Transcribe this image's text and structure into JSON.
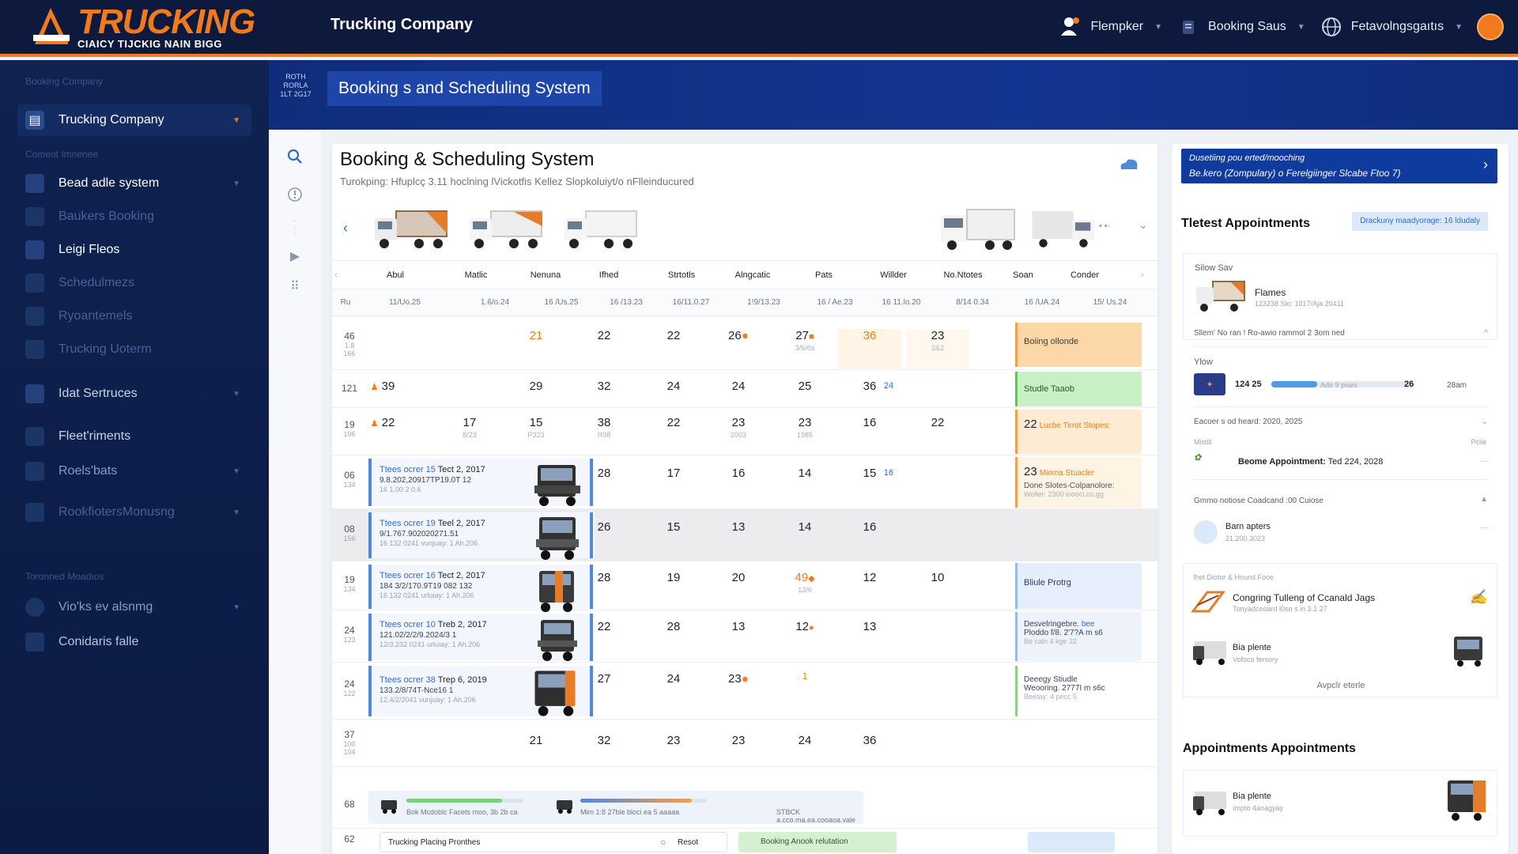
{
  "header": {
    "logo_title": "TRUCKING",
    "logo_sub": "CIAICY TIJCKIG NAIN BIGG",
    "app_title": "Trucking Company",
    "menu": [
      {
        "label": "Flempker",
        "icon": "user-truck-icon"
      },
      {
        "label": "Booking Saus",
        "icon": "clipboard-icon"
      },
      {
        "label": "Fetavolngsgaıtıs",
        "icon": "globe-icon"
      }
    ]
  },
  "sidebar": {
    "section1": "Booking Company",
    "company": "Trucking Company",
    "section2": "Comeot Imnenee",
    "items": [
      "Bead adle system",
      "Baukers Booking",
      "Leigi Fleos",
      "Schedulmezs",
      "Ryoantemels",
      "Trucking Uoterm",
      "Idat Sertruces",
      "Fleet'riments",
      "Roels'bats",
      "RookfiotersMonusng"
    ],
    "section3": "Toronned Moadıos",
    "items2": [
      "Vio'ks ev alsnmg",
      "Conidaris falle"
    ]
  },
  "banner": {
    "stamp": "ROTH RORLA 1LT 2G17",
    "title": "Booking s and Scheduling System"
  },
  "main": {
    "title": "Booking & Scheduling System",
    "subtitle": "Turokping: Hfuplcç 3.11 hoclning lVickotfis Kellez Slopkoluiyt/o nFlleinducured",
    "columns": [
      "Abul",
      "Matlic",
      "Nenuna",
      "Ifhed",
      "Strtotls",
      "Alngcatic",
      "Pats",
      "Willder",
      "No.Ntotes",
      "Soan",
      "Conder"
    ],
    "dates": [
      "Ru",
      "11/Uo.25",
      "1.6/o.24",
      "16 /Us.25",
      "16 /13.23",
      "16/11.0.27",
      "1!9/13.23",
      "16 / Ae.23",
      "16 11.lo.20",
      "8/14 0.34",
      "16 /UA.24",
      "15/ Us.24"
    ],
    "rows": [
      {
        "label": "46",
        "sub": "1.8 166",
        "cells": [
          "",
          "21",
          "22",
          "22",
          "26",
          "27",
          "36",
          "23"
        ],
        "cell_subs": [
          "",
          "",
          "",
          "",
          "",
          "3/6/6s",
          "",
          "2&2"
        ],
        "status": "Boiing ollonde",
        "status_sub": ""
      },
      {
        "label": "121",
        "sub": "",
        "cells": [
          "39",
          "29",
          "32",
          "24",
          "24",
          "25",
          "36",
          "24"
        ],
        "cell_subs": [],
        "status": "Studle Taaob",
        "status_sub": ""
      },
      {
        "label": "19",
        "sub": "196",
        "cells": [
          "22",
          "17",
          "15",
          "38",
          "22",
          "23",
          "23",
          "16",
          "22"
        ],
        "cell_subs": [
          "",
          "8/23",
          "P323",
          "R98",
          "",
          "2003",
          "1985",
          "",
          ""
        ],
        "status": "22",
        "status_sub": "Lucbe Tirrot Stopes:"
      },
      {
        "label": "06",
        "sub": "134",
        "card": {
          "line1": "Ttees ocrer 15",
          "date": "Tect 2, 2017",
          "line2": "9.8.202,20917TP19.0T 12",
          "line3": "16 1,00 2 0.6"
        },
        "cells": [
          "28",
          "17",
          "16",
          "14",
          "15",
          "16"
        ],
        "status": "23",
        "status_sub": "Mioma Stuacler",
        "status_lines": [
          "Done Slotes-Colpanolore:",
          "Weller: 2300 ioooci.co.gg"
        ]
      },
      {
        "label": "08",
        "sub": "156",
        "card": {
          "line1": "Ttees ocrer 19",
          "date": "Teel 2, 2017",
          "line2": "9/1.767.902020271.51",
          "line3": "16 132 0241 vunjuay: 1 Ah.206"
        },
        "cells": [
          "26",
          "15",
          "13",
          "14",
          "16"
        ],
        "status": "",
        "status_sub": ""
      },
      {
        "label": "19",
        "sub": "134",
        "card": {
          "line1": "Ttees ocrer 16",
          "date": "Tect 2, 2017",
          "line2": "184 3/2/170.9T19 082 132",
          "line3": "16.132 0241 urluiay: 1 Ah.206"
        },
        "cells": [
          "28",
          "19",
          "20",
          "49",
          "12",
          "10"
        ],
        "cell_subs": [
          "",
          "",
          "",
          "12/6",
          "",
          ""
        ],
        "status": "Bliule Protrg",
        "status_sub": ""
      },
      {
        "label": "24",
        "sub": "123",
        "card": {
          "line1": "Ttees ocrer 10",
          "date": "Treb 2, 2017",
          "line2": "121.02/2/2/9.2024/3 1",
          "line3": "12/3.232 0241 urluiay: 1 Ah.206"
        },
        "cells": [
          "22",
          "28",
          "13",
          "12",
          "13"
        ],
        "status": "Desvelringebre. ",
        "status_sub": "Ploddo f/8. 2'7?A m s6",
        "status_lines": [
          "Be caln 4 kge 22"
        ]
      },
      {
        "label": "24",
        "sub": "122",
        "card": {
          "line1": "Ttees ocrer 38",
          "date": "Trep 6, 2019",
          "line2": "133.2/8/74T-Nce16 1",
          "line3": "12.4/2/2041 vunjuay: 1 Ah.206"
        },
        "cells": [
          "27",
          "24",
          "23",
          "1"
        ],
        "status": "Deeegy Stiudle",
        "status_sub": "Weooring. 2777I m s6c",
        "status_lines": [
          "Beetay: 4 pecc 5"
        ]
      },
      {
        "label": "37",
        "sub": "100 104",
        "cells": [
          "21",
          "32",
          "23",
          "23",
          "24",
          "36"
        ],
        "status": "",
        "status_sub": ""
      }
    ],
    "progress": {
      "label_a": "Bok Mcdoblc Facets moo, 3b 2b ca",
      "label_b": "Mim 1:8 27ble bloci ea 5 aaaaa",
      "label_c": "STBCK a.cco.ma.ea.cooaoa.vale",
      "value_a": 0.82,
      "value_b": 0.88,
      "row_label": "68"
    },
    "bottom": {
      "row_label": "62",
      "left": "Trucking Placing Pronthes",
      "btn": "Resot",
      "green": "Booking Anook relutation"
    }
  },
  "right": {
    "promo_line1": "Dusetiing pou erted/mooching",
    "promo_line2": "Be.kero (Zompulary) o Ferelgiinger Slcabe Ftoo 7)",
    "title": "Tletest  Appointments",
    "badge": "Drackuny maadyorage: 16 ldudaly",
    "card1": {
      "label": "Silow Sav",
      "name": "Flames",
      "meta": "123238 Slo: 1017/Aja 20411"
    },
    "row_a": "Sllem' No ran ! Ro-awio rammol 2 3om ned",
    "view_label": "Ylow",
    "progress": {
      "left": "124 25",
      "text": "Ado 9 pises",
      "count": "26",
      "right": "28am",
      "value": 0.32
    },
    "row_b": "Eacoer s od heard: 2020, 2025",
    "misc_label": "Mistill",
    "misc_right": "Pclie",
    "appt": {
      "text": "Beome Appointment:",
      "date": "Ted 224, 2028"
    },
    "row_c": "Gmmo notiose Coadcand :00 Cuiose",
    "card2": {
      "name": "Barn apters",
      "meta": "21.200.3023"
    },
    "card3": {
      "label": "Ihet Diotur & Hound Fooe",
      "name": "Congring  Tulleng of Ccanald Jags",
      "meta": "Tonyadcooard l0so s in 3.1 27"
    },
    "card4": {
      "name": "Bia plente",
      "meta": "Vofoco fersory"
    },
    "more": "Avpclr eterle",
    "title2": "Appointments Appointments",
    "card5": {
      "name": "Bia plente",
      "meta": "Impto 4anagyay"
    }
  }
}
